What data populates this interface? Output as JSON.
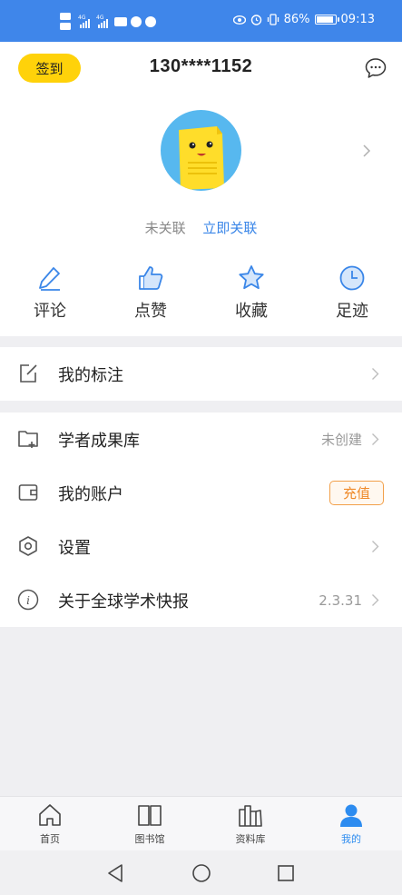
{
  "status_bar": {
    "left_glyphs": "HD 4G .ıl 4G .ıl",
    "battery_pct": "86%",
    "time": "09:13",
    "battery_level": 0.86
  },
  "header": {
    "checkin_label": "签到",
    "phone": "130****1152"
  },
  "profile": {
    "unlinked_text": "未关联",
    "link_action": "立即关联"
  },
  "quick_actions": [
    {
      "label": "评论",
      "icon": "pencil-icon"
    },
    {
      "label": "点赞",
      "icon": "thumbs-up-icon"
    },
    {
      "label": "收藏",
      "icon": "star-icon"
    },
    {
      "label": "足迹",
      "icon": "clock-icon"
    }
  ],
  "menu": {
    "annotations": "我的标注",
    "scholar_repo": "学者成果库",
    "scholar_repo_status": "未创建",
    "account": "我的账户",
    "recharge": "充值",
    "settings": "设置",
    "about": "关于全球学术快报",
    "version": "2.3.31"
  },
  "bottom_nav": [
    {
      "label": "首页",
      "icon": "home-icon"
    },
    {
      "label": "图书馆",
      "icon": "book-icon"
    },
    {
      "label": "资料库",
      "icon": "library-icon"
    },
    {
      "label": "我的",
      "icon": "user-icon",
      "active": true
    }
  ],
  "colors": {
    "status_bar": "#3f86ea",
    "accent": "#3a86e8",
    "checkin": "#ffd20a",
    "recharge": "#ef8a2a"
  }
}
